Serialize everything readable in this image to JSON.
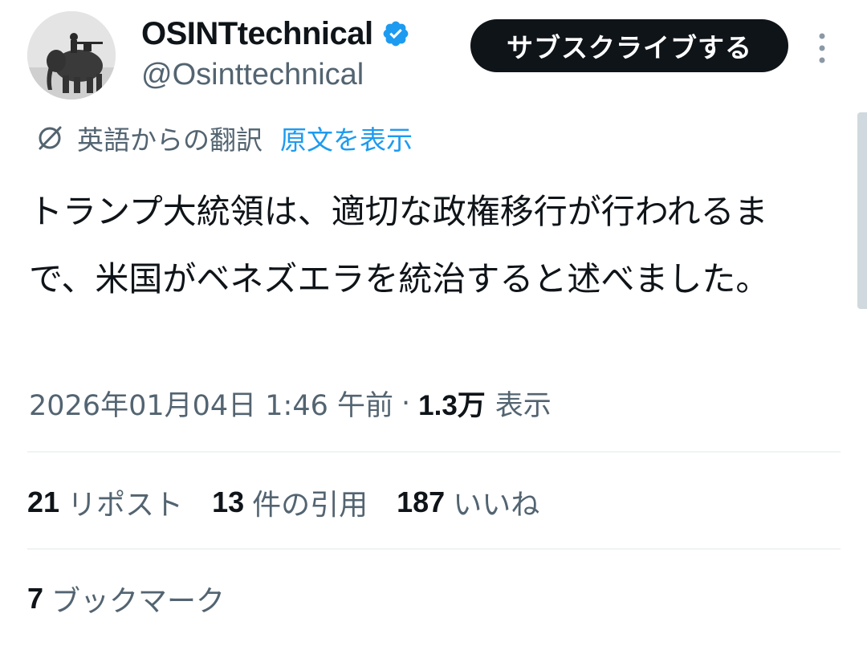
{
  "author": {
    "display_name": "OSINTtechnical",
    "handle": "@Osinttechnical",
    "verified": true
  },
  "subscribe_button": {
    "label": "サブスクライブする"
  },
  "translation": {
    "label": "英語からの翻訳",
    "show_original": "原文を表示"
  },
  "tweet": {
    "text": "トランプ大統領は、適切な政権移行が行われるまで、米国がベネズエラを統治すると述べました。",
    "timestamp": "2026年01月04日 1:46 午前",
    "separator": "·",
    "views_count": "1.3万",
    "views_label": "表示"
  },
  "stats": {
    "reposts_count": "21",
    "reposts_label": "リポスト",
    "quotes_count": "13",
    "quotes_label": "件の引用",
    "likes_count": "187",
    "likes_label": "いいね",
    "bookmarks_count": "7",
    "bookmarks_label": "ブックマーク"
  },
  "icons": {
    "verified": "verified-badge-icon",
    "more": "more-vertical-icon",
    "translate": "translate-icon",
    "avatar": "avatar-image"
  },
  "colors": {
    "text_primary": "#0f1419",
    "text_secondary": "#536471",
    "link": "#1d9bf0",
    "button_bg": "#0f1419",
    "button_text": "#ffffff",
    "divider": "#eff3f4"
  }
}
